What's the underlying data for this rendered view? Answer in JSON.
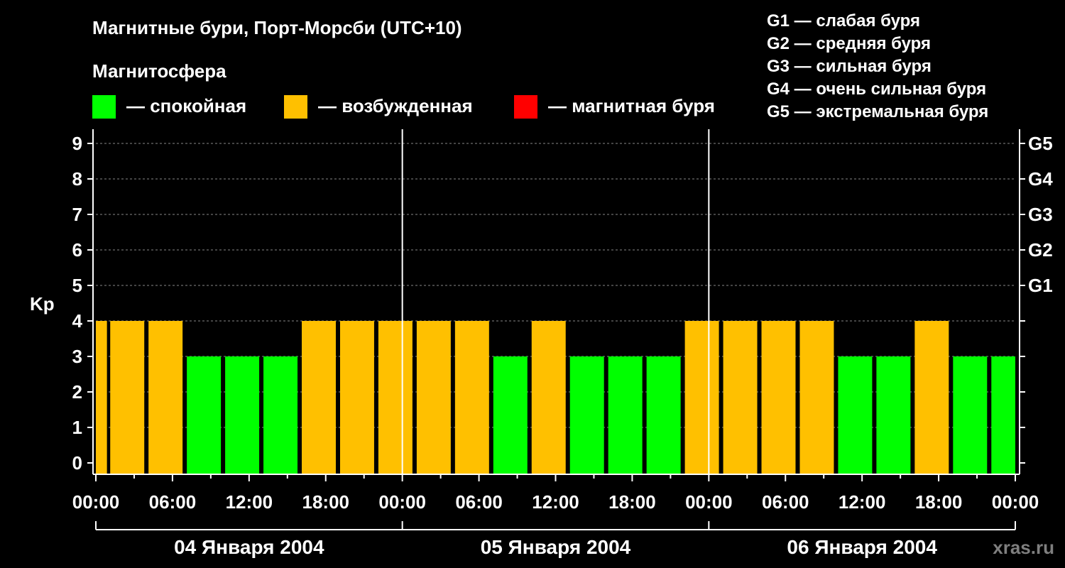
{
  "header": {
    "title": "Магнитные бури, Порт-Морсби (UTC+10)",
    "subtitle": "Магнитосфера"
  },
  "legend": [
    {
      "label": "— спокойная",
      "color": "#00ff00"
    },
    {
      "label": "— возбужденная",
      "color": "#ffc000"
    },
    {
      "label": "— магнитная буря",
      "color": "#ff0000"
    }
  ],
  "storm_legend": [
    "G1 — слабая буря",
    "G2 — средняя буря",
    "G3 — сильная буря",
    "G4 — очень сильная буря",
    "G5 — экстремальная буря"
  ],
  "watermark": "xras.ru",
  "chart_data": {
    "type": "bar",
    "ylabel": "Kp",
    "ylim": [
      0,
      9
    ],
    "grid": true,
    "y_ticks": [
      "0",
      "1",
      "2",
      "3",
      "4",
      "5",
      "6",
      "7",
      "8",
      "9"
    ],
    "right_ticks": [
      {
        "kp": 5,
        "label": "G1"
      },
      {
        "kp": 6,
        "label": "G2"
      },
      {
        "kp": 7,
        "label": "G3"
      },
      {
        "kp": 8,
        "label": "G4"
      },
      {
        "kp": 9,
        "label": "G5"
      }
    ],
    "x_tick_labels": [
      "00:00",
      "06:00",
      "12:00",
      "18:00",
      "00:00",
      "06:00",
      "12:00",
      "18:00",
      "00:00",
      "06:00",
      "12:00",
      "18:00",
      "00:00"
    ],
    "dates": [
      "04 Января 2004",
      "05 Января 2004",
      "06 Января 2004"
    ],
    "values": [
      4,
      4,
      4,
      3,
      3,
      3,
      4,
      4,
      4,
      4,
      4,
      3,
      4,
      3,
      3,
      3,
      4,
      4,
      4,
      4,
      3,
      3,
      4,
      3,
      3
    ],
    "thresholds": {
      "quiet_max": 3,
      "active_max": 4
    },
    "colors": {
      "quiet": "#00ff00",
      "active": "#ffc000",
      "storm": "#ff0000",
      "grid": "#888888",
      "axis": "#ffffff"
    }
  }
}
